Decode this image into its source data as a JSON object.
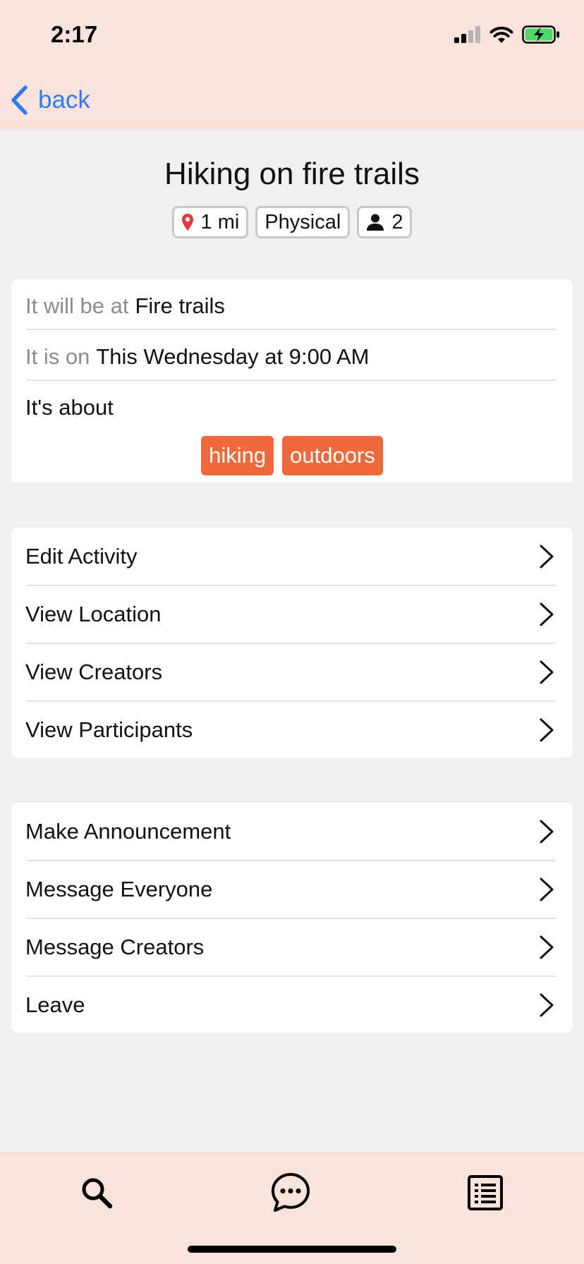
{
  "status_bar": {
    "time": "2:17"
  },
  "nav": {
    "back_label": "back"
  },
  "activity": {
    "title": "Hiking on fire trails",
    "chips": {
      "distance": "1 mi",
      "category": "Physical",
      "participants": "2"
    },
    "where_prefix": "It will be at",
    "where_value": "Fire trails",
    "when_prefix": "It is on",
    "when_value": "This Wednesday at 9:00 AM",
    "about_label": "It's about",
    "tags": [
      "hiking",
      "outdoors"
    ]
  },
  "menu_group_1": [
    "Edit Activity",
    "View Location",
    "View Creators",
    "View Participants"
  ],
  "menu_group_2": [
    "Make Announcement",
    "Message Everyone",
    "Message Creators",
    "Leave"
  ],
  "tabbar": {
    "icons": [
      "search-icon",
      "chat-bubble-icon",
      "list-icon"
    ]
  },
  "colors": {
    "accent_blue": "#2f7cf6",
    "tag_orange": "#ee6a3c",
    "bar_background": "#fbe2da",
    "pin_red": "#e23a3a",
    "battery_green": "#4cd964"
  }
}
